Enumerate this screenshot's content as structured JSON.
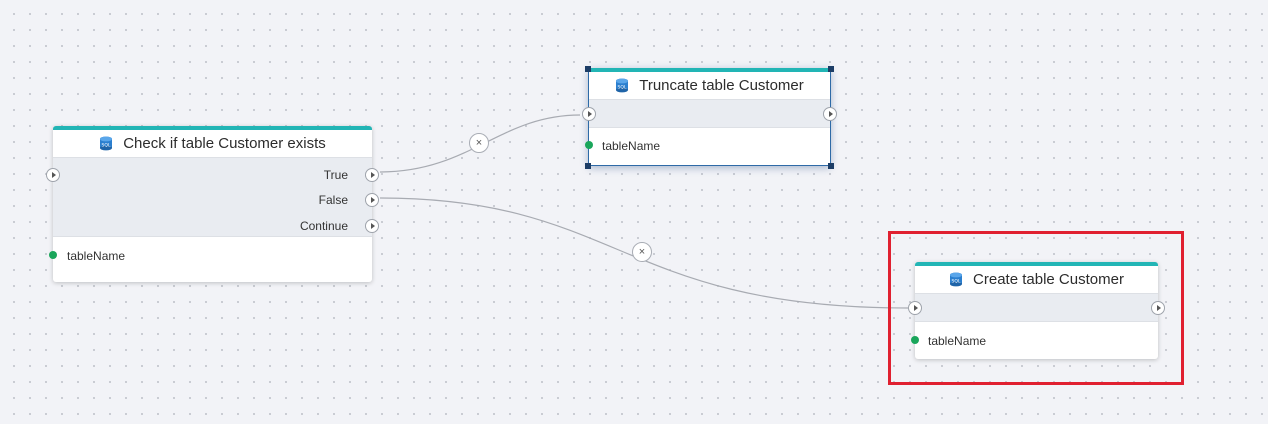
{
  "nodes": {
    "check": {
      "title": "Check if table Customer exists",
      "icon": "sql-database-icon",
      "outputs": [
        "True",
        "False",
        "Continue"
      ],
      "param": "tableName"
    },
    "truncate": {
      "title": "Truncate table Customer",
      "icon": "sql-database-icon",
      "param": "tableName",
      "selected": true
    },
    "create": {
      "title": "Create table Customer",
      "icon": "sql-database-icon",
      "param": "tableName",
      "highlighted": true
    }
  },
  "links": [
    {
      "from": "check.True",
      "to": "truncate.in",
      "delete_label": "×"
    },
    {
      "from": "check.False",
      "to": "create.in",
      "delete_label": "×"
    }
  ],
  "colors": {
    "node_accent": "#22b5b5",
    "param_dot": "#1aa65b",
    "highlight": "#e02030",
    "selection": "#1c3d66"
  }
}
